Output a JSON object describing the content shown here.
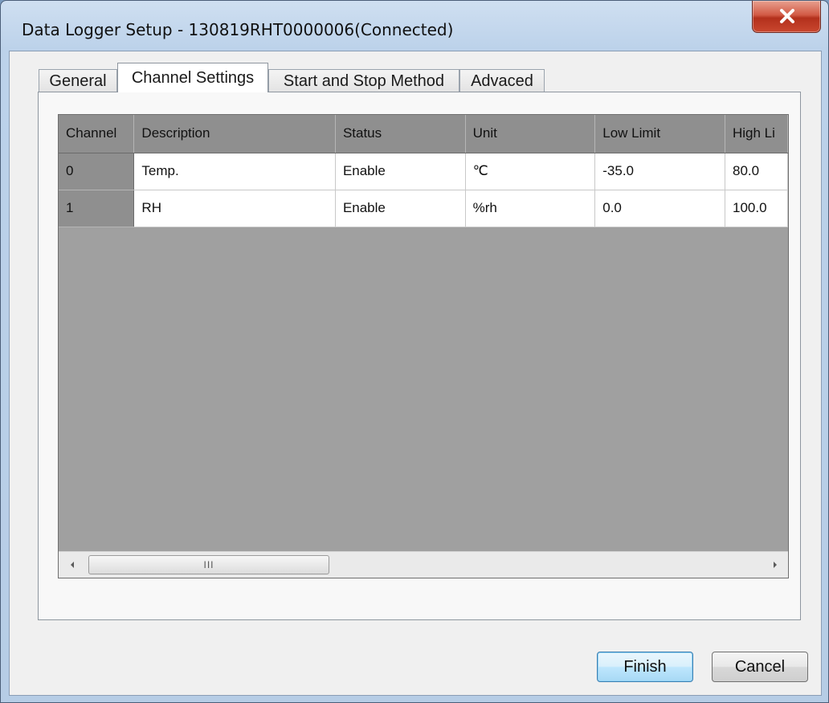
{
  "window": {
    "title": "Data Logger Setup - 130819RHT0000006(Connected)"
  },
  "tabs": [
    {
      "label": "General",
      "active": false
    },
    {
      "label": "Channel Settings",
      "active": true
    },
    {
      "label": "Start and Stop Method",
      "active": false
    },
    {
      "label": "Advaced",
      "active": false
    }
  ],
  "grid": {
    "columns": [
      "Channel",
      "Description",
      "Status",
      "Unit",
      "Low Limit",
      "High Li"
    ],
    "rows": [
      {
        "channel": "0",
        "description": "Temp.",
        "status": "Enable",
        "unit": "℃",
        "low_limit": "-35.0",
        "high_limit": "80.0"
      },
      {
        "channel": "1",
        "description": "RH",
        "status": "Enable",
        "unit": "%rh",
        "low_limit": "0.0",
        "high_limit": "100.0"
      }
    ],
    "scrollbar_grip": "III"
  },
  "buttons": {
    "finish": "Finish",
    "cancel": "Cancel"
  }
}
